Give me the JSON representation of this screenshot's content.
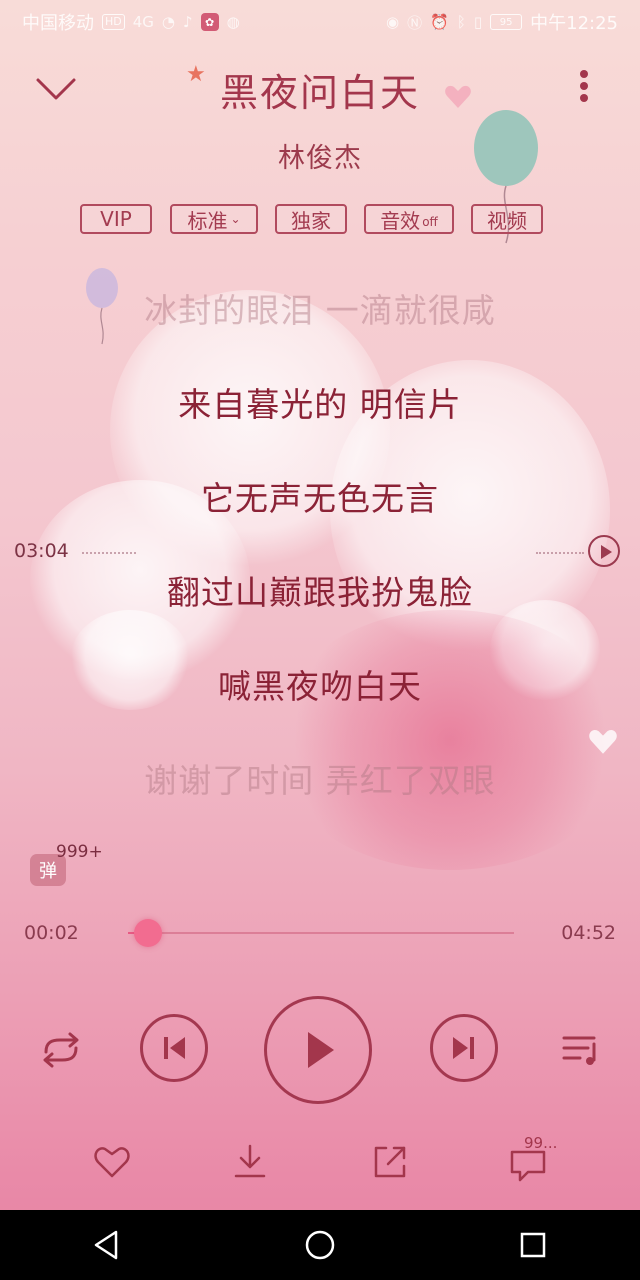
{
  "status_bar": {
    "carrier": "中国移动",
    "network_badge": "HD",
    "signal": "4G",
    "battery": "95",
    "time": "中午12:25"
  },
  "header": {
    "title": "黑夜问白天",
    "artist": "林俊杰"
  },
  "tags": {
    "vip": "VIP",
    "quality": "标准",
    "exclusive": "独家",
    "sound_effect": "音效",
    "sound_effect_state": "off",
    "video": "视频"
  },
  "lyrics": [
    "冰封的眼泪 一滴就很咸",
    "来自暮光的 明信片",
    "它无声无色无言",
    "翻过山巅跟我扮鬼脸",
    "喊黑夜吻白天",
    "谢谢了时间 弄红了双眼"
  ],
  "seek": {
    "time": "03:04"
  },
  "danmu": {
    "icon_text": "弹",
    "count": "999+"
  },
  "player": {
    "current_time": "00:02",
    "total_time": "04:52",
    "progress_fraction": 0.01
  },
  "bottom": {
    "comment_count": "99..."
  },
  "icons": {
    "collapse": "chevron-down-icon",
    "more": "more-vertical-icon",
    "loop": "repeat-icon",
    "prev": "skip-previous-icon",
    "play": "play-icon",
    "next": "skip-next-icon",
    "playlist": "playlist-icon",
    "like": "heart-icon",
    "download": "download-icon",
    "share": "share-icon",
    "comment": "comment-icon"
  },
  "colors": {
    "accent": "#a3364c",
    "thumb": "#f26c90"
  }
}
